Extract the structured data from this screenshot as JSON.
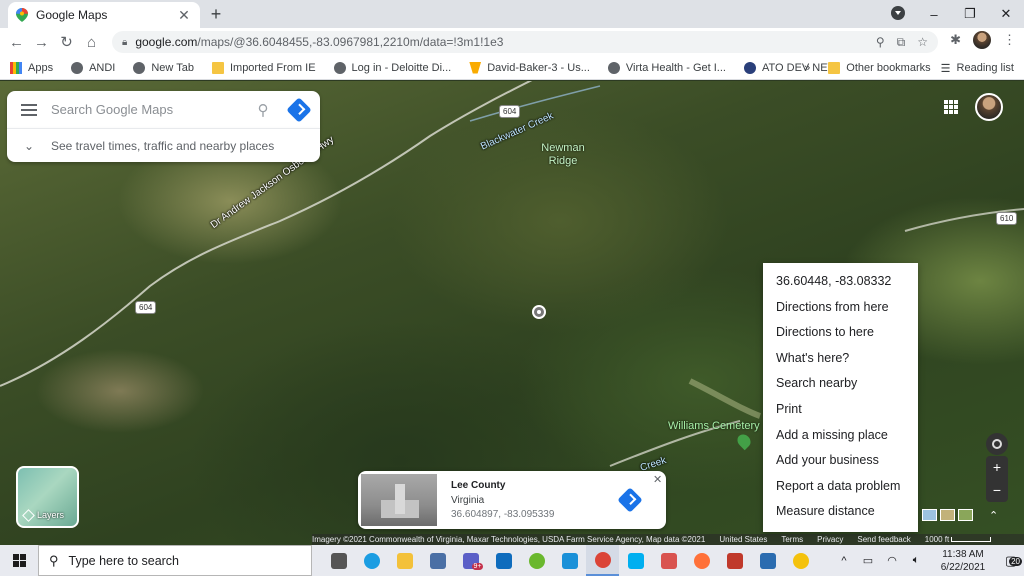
{
  "browser": {
    "tab_title": "Google Maps",
    "tab_close": "✕",
    "new_tab": "+",
    "window_controls": {
      "minimize": "–",
      "restore": "❐",
      "close": "✕"
    },
    "url_host": "google.com",
    "url_path": "/maps/@36.6048455,-83.0967981,2210m/data=!3m1!1e3"
  },
  "bookmarks": {
    "items": [
      {
        "label": "Apps",
        "icon": "grid-icon"
      },
      {
        "label": "ANDI",
        "icon": "globe-icon"
      },
      {
        "label": "New Tab",
        "icon": "globe-icon"
      },
      {
        "label": "Imported From IE",
        "icon": "folder-icon"
      },
      {
        "label": "Log in - Deloitte Di...",
        "icon": "globe-icon"
      },
      {
        "label": "David-Baker-3 - Us...",
        "icon": "star-icon"
      },
      {
        "label": "Virta Health - Get I...",
        "icon": "globe-icon"
      },
      {
        "label": "ATO DEV NEW",
        "icon": "ato-icon"
      }
    ],
    "overflow": "»",
    "other": "Other bookmarks",
    "reading_list": "Reading list"
  },
  "maps": {
    "search_placeholder": "Search Google Maps",
    "travel_prompt": "See travel times, traffic and nearby places",
    "labels": {
      "creek_top": "Blackwater Creek",
      "creek_bottom": "Creek",
      "highway": "Dr Andrew Jackson Osborne Hwy",
      "ridge": "Newman Ridge",
      "cemetery": "Williams Cemetery"
    },
    "shields": [
      "604",
      "604",
      "610"
    ],
    "context_menu": [
      "36.60448, -83.08332",
      "Directions from here",
      "Directions to here",
      "What's here?",
      "Search nearby",
      "Print",
      "Add a missing place",
      "Add your business",
      "Report a data problem",
      "Measure distance"
    ],
    "layers_label": "Layers",
    "zoom_in": "+",
    "zoom_out": "−",
    "info_card": {
      "name": "Lee County",
      "region": "Virginia",
      "coords": "36.604897, -83.095339",
      "close": "✕"
    },
    "attribution": {
      "imagery": "Imagery ©2021 Commonwealth of Virginia, Maxar Technologies, USDA Farm Service Agency, Map data ©2021",
      "country": "United States",
      "terms": "Terms",
      "privacy": "Privacy",
      "feedback": "Send feedback",
      "scale": "1000 ft"
    }
  },
  "taskbar": {
    "search_placeholder": "Type here to search",
    "apps": [
      {
        "name": "task-view-icon",
        "color": "#555555"
      },
      {
        "name": "edge-icon",
        "color": "#1b9de2"
      },
      {
        "name": "file-explorer-icon",
        "color": "#f3c13a"
      },
      {
        "name": "calculator-icon",
        "color": "#4a6fa5"
      },
      {
        "name": "teams-icon",
        "color": "#5b5fc7"
      },
      {
        "name": "outlook-icon",
        "color": "#0f6cbd"
      },
      {
        "name": "green-app-icon",
        "color": "#6ab82e"
      },
      {
        "name": "skype-business-icon",
        "color": "#1a90d8"
      },
      {
        "name": "chrome-icon",
        "color": "#db4437"
      },
      {
        "name": "skype-icon",
        "color": "#00aff0"
      },
      {
        "name": "package-icon",
        "color": "#d9534f"
      },
      {
        "name": "firefox-icon",
        "color": "#ff7139"
      },
      {
        "name": "snipping-icon",
        "color": "#c0392b"
      },
      {
        "name": "photos-icon",
        "color": "#2b6cb0"
      },
      {
        "name": "sticky-icon",
        "color": "#f4c20d"
      }
    ],
    "teams_badge": "9+",
    "tray": {
      "chevron": "^",
      "time": "11:38 AM",
      "date": "6/22/2021",
      "notifications": "20"
    }
  }
}
